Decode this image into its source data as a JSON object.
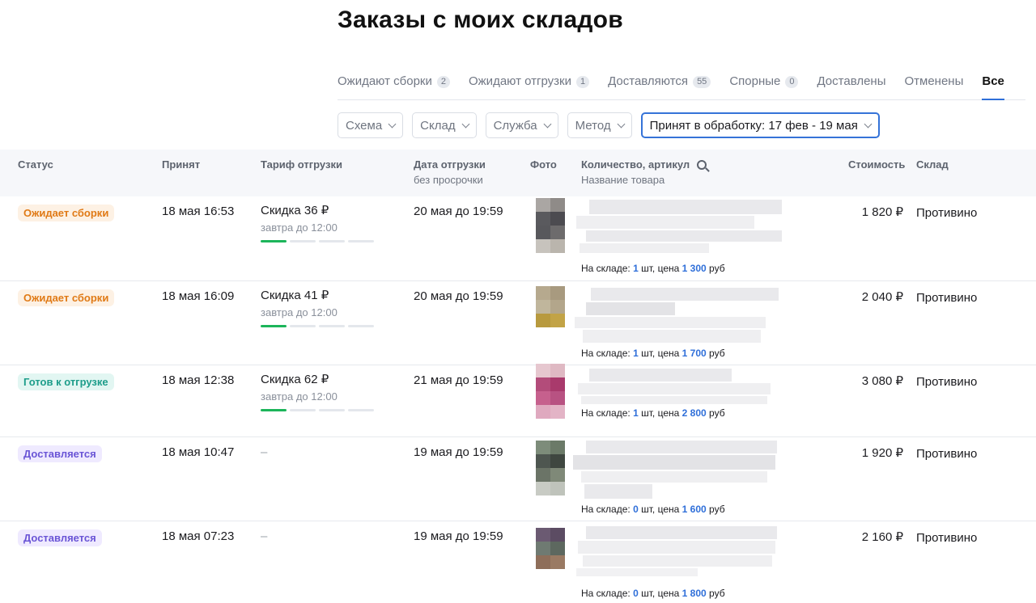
{
  "page": {
    "title": "Заказы с моих складов"
  },
  "tabs": [
    {
      "label": "Ожидают сборки",
      "count": "2"
    },
    {
      "label": "Ожидают отгрузки",
      "count": "1"
    },
    {
      "label": "Доставляются",
      "count": "55"
    },
    {
      "label": "Спорные",
      "count": "0"
    },
    {
      "label": "Доставлены",
      "count": ""
    },
    {
      "label": "Отменены",
      "count": ""
    },
    {
      "label": "Все",
      "count": ""
    }
  ],
  "filters": [
    {
      "label": "Схема"
    },
    {
      "label": "Склад"
    },
    {
      "label": "Служба"
    },
    {
      "label": "Метод"
    },
    {
      "label": "Принят в обработку: 17 фев - 19 мая"
    }
  ],
  "columns": {
    "status": "Статус",
    "accepted": "Принят",
    "tariff": "Тариф отгрузки",
    "ship_date": "Дата отгрузки",
    "ship_date_sub": "без просрочки",
    "photo": "Фото",
    "qty": "Количество, артикул",
    "qty_sub": "Название товара",
    "cost": "Стоимость",
    "warehouse": "Склад"
  },
  "stock_template": {
    "prefix": "На складе:",
    "unit": "шт, цена",
    "currency": "руб"
  },
  "orders": [
    {
      "status": "Ожидает сборки",
      "accepted": "18 мая 16:53",
      "tariff": "Скидка 36 ₽",
      "tariff_deadline": "завтра до 12:00",
      "ship_date": "20 мая до 19:59",
      "stock_qty": "1",
      "stock_price": "1 300",
      "cost": "1 820 ₽",
      "warehouse": "Противино"
    },
    {
      "status": "Ожидает сборки",
      "accepted": "18 мая 16:09",
      "tariff": "Скидка 41 ₽",
      "tariff_deadline": "завтра до 12:00",
      "ship_date": "20 мая до 19:59",
      "stock_qty": "1",
      "stock_price": "1 700",
      "cost": "2 040 ₽",
      "warehouse": "Противино"
    },
    {
      "status": "Готов к отгрузке",
      "accepted": "18 мая 12:38",
      "tariff": "Скидка 62 ₽",
      "tariff_deadline": "завтра до 12:00",
      "ship_date": "21 мая до 19:59",
      "stock_qty": "1",
      "stock_price": "2 800",
      "cost": "3 080 ₽",
      "warehouse": "Противино"
    },
    {
      "status": "Доставляется",
      "accepted": "18 мая 10:47",
      "tariff": "–",
      "tariff_deadline": "",
      "ship_date": "19 мая до 19:59",
      "stock_qty": "0",
      "stock_price": "1 600",
      "cost": "1 920 ₽",
      "warehouse": "Противино"
    },
    {
      "status": "Доставляется",
      "accepted": "18 мая 07:23",
      "tariff": "–",
      "tariff_deadline": "",
      "ship_date": "19 мая до 19:59",
      "stock_qty": "0",
      "stock_price": "1 800",
      "cost": "2 160 ₽",
      "warehouse": "Противино"
    }
  ]
}
